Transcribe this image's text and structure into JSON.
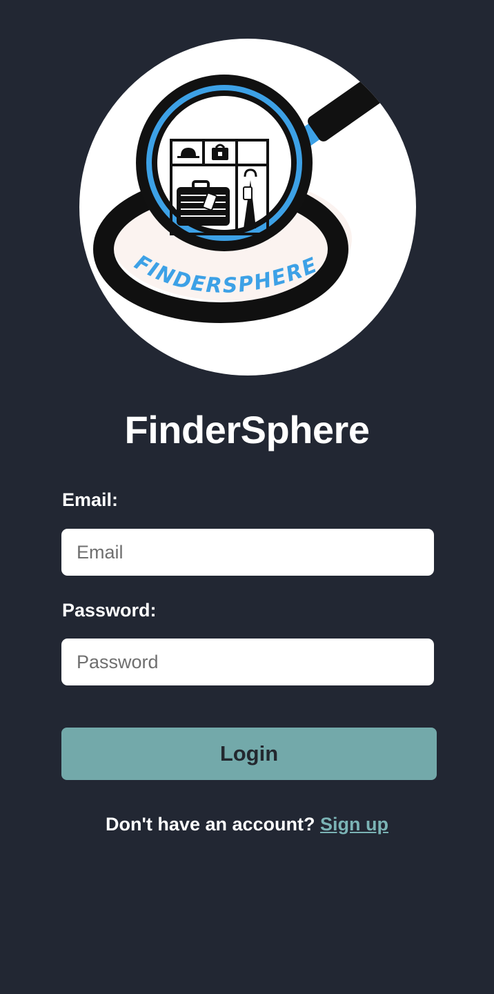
{
  "brand": {
    "logo_text": "FINDERSPHERE",
    "app_title": "FinderSphere"
  },
  "form": {
    "email_label": "Email:",
    "email_placeholder": "Email",
    "email_value": "",
    "password_label": "Password:",
    "password_placeholder": "Password",
    "password_value": "",
    "login_label": "Login"
  },
  "signup": {
    "prompt": "Don't have an account?",
    "link_label": "Sign up"
  },
  "colors": {
    "background": "#222733",
    "accent": "#73a9aa",
    "link": "#7bb3b5",
    "logo_blue": "#3da1e6"
  },
  "icons": {
    "logo": "magnifier-lost-and-found-logo"
  }
}
